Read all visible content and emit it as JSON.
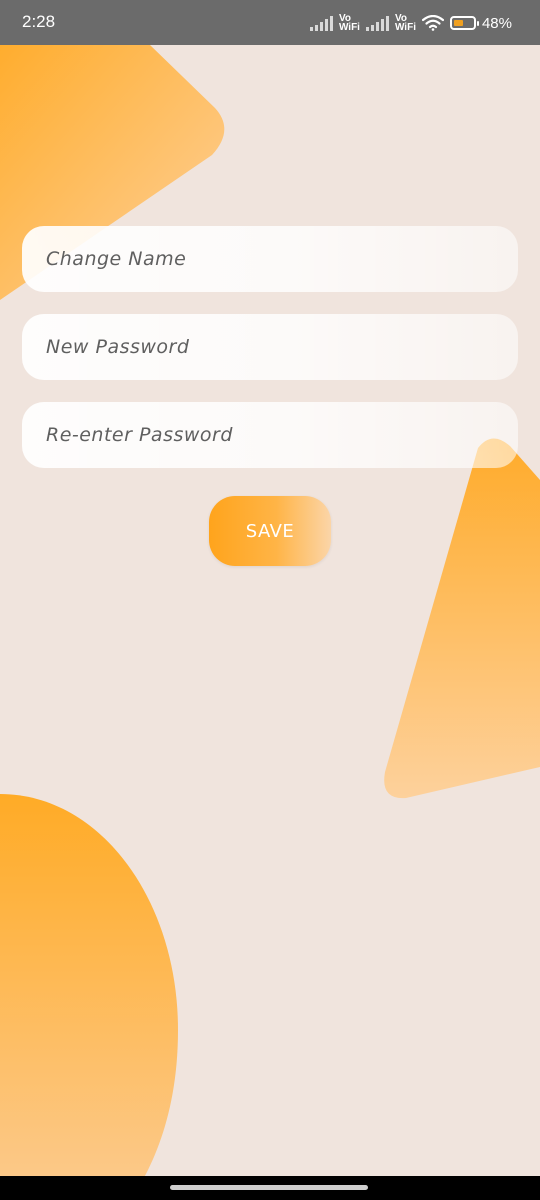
{
  "status_bar": {
    "time": "2:28",
    "vowifi_1_top": "Vo",
    "vowifi_1_bottom": "WiFi",
    "vowifi_2_top": "Vo",
    "vowifi_2_bottom": "WiFi",
    "battery_percent": "48%",
    "battery_level": 0.48,
    "icons": [
      "signal-icon",
      "wifi-icon",
      "battery-icon"
    ]
  },
  "form": {
    "change_name_placeholder": "Change Name",
    "new_password_placeholder": "New Password",
    "reenter_password_placeholder": "Re-enter Password",
    "save_label": "SAVE"
  },
  "colors": {
    "background": "#f0e4dd",
    "accent": "#ffa41c",
    "accent_light": "#fbd5a8",
    "status_bar": "#6b6b6b"
  }
}
